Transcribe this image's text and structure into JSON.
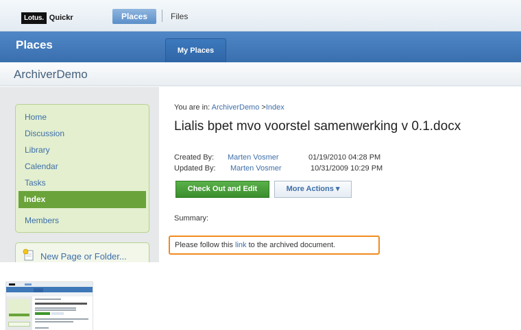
{
  "header": {
    "logo_brand": "Lotus.",
    "logo_product": "Quickr",
    "tabs": [
      {
        "label": "Places",
        "active": true
      },
      {
        "label": "Files",
        "active": false
      }
    ]
  },
  "places_band": {
    "title": "Places",
    "tab_label": "My Places"
  },
  "place": {
    "title": "ArchiverDemo"
  },
  "sidebar": {
    "items": [
      {
        "label": "Home",
        "active": false
      },
      {
        "label": "Discussion",
        "active": false
      },
      {
        "label": "Library",
        "active": false
      },
      {
        "label": "Calendar",
        "active": false
      },
      {
        "label": "Tasks",
        "active": false
      },
      {
        "label": "Index",
        "active": true
      },
      {
        "label": "Members",
        "active": false
      }
    ],
    "new_page_label": "New Page or Folder..."
  },
  "main": {
    "breadcrumb_prefix": "You are in:",
    "breadcrumb_place": "ArchiverDemo",
    "breadcrumb_sep": " >",
    "breadcrumb_page": "Index",
    "doc_title": "Lialis bpet mvo voorstel samenwerking v 0.1.docx",
    "created_label": "Created By:",
    "created_user": "Marten Vosmer",
    "created_date": "01/19/2010 04:28 PM",
    "updated_label": "Updated By:",
    "updated_user": "Marten Vosmer",
    "updated_date": "10/31/2009 10:29 PM",
    "checkout_button": "Check Out and Edit",
    "more_actions_button": "More Actions ▾",
    "summary_label": "Summary:",
    "notice_before": "Please follow this ",
    "notice_link": "link",
    "notice_after": " to the archived document."
  },
  "colors": {
    "accent_blue": "#3d6ea8",
    "nav_active_green": "#6aa33a",
    "checkout_green": "#3a8d2c",
    "notice_border_orange": "#f08a1c"
  }
}
